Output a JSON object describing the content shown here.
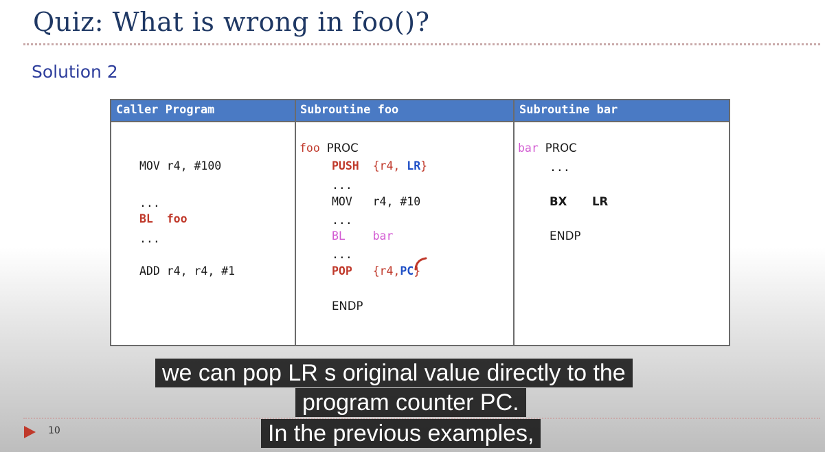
{
  "slide": {
    "title": "Quiz: What is wrong in foo()?",
    "subtitle": "Solution 2",
    "page_number": "10"
  },
  "table": {
    "headers": [
      "Caller Program",
      "Subroutine foo",
      "Subroutine bar"
    ],
    "caller": {
      "mov_line": "MOV r4, #100",
      "dots1": "...",
      "bl_op": "BL",
      "bl_target": "foo",
      "dots2": "...",
      "add_line": "ADD r4, r4, #1"
    },
    "foo": {
      "label": "foo",
      "proc": "PROC",
      "push_op": "PUSH",
      "push_open": "{r4, ",
      "push_lr": "LR",
      "push_close": "}",
      "dots1": "...",
      "mov_op": "MOV",
      "mov_args": "r4, #10",
      "dots2": "...",
      "bl_op": "BL",
      "bl_target": "bar",
      "dots3": "...",
      "pop_op": "POP",
      "pop_open": "{r4,",
      "pop_pc": "PC",
      "pop_close": "}",
      "endp": "ENDP"
    },
    "bar": {
      "label": "bar",
      "proc": "PROC",
      "dots": "...",
      "bx_op": "BX",
      "bx_arg": "LR",
      "endp": "ENDP"
    }
  },
  "captions": [
    "we can pop LR s original value directly to the",
    "program counter PC.",
    "In the previous examples,"
  ],
  "colors": {
    "title": "#1f3864",
    "subtitle": "#2e3e9c",
    "header_bg": "#4a7ac4",
    "instruction_red": "#c0392b",
    "register_blue": "#1f4fc6",
    "label_magenta": "#d25ad2"
  }
}
